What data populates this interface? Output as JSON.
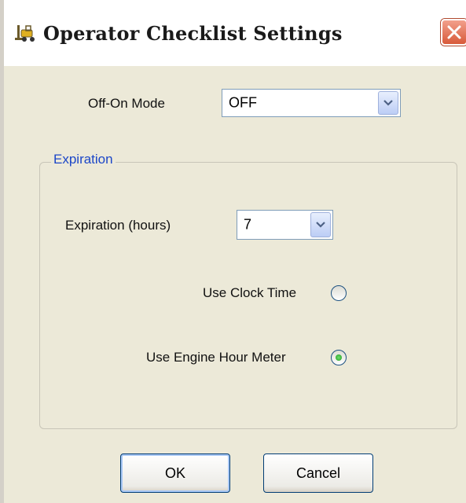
{
  "window": {
    "title": "Operator Checklist Settings",
    "icon": "forklift-icon",
    "close_icon": "close-icon"
  },
  "off_on_mode": {
    "label": "Off-On Mode",
    "selected": "OFF"
  },
  "expiration_group": {
    "legend": "Expiration",
    "hours_label": "Expiration (hours)",
    "hours_selected": "7",
    "options": [
      {
        "label": "Use Clock Time",
        "selected": false
      },
      {
        "label": "Use Engine Hour Meter",
        "selected": true
      }
    ]
  },
  "buttons": {
    "ok_label": "OK",
    "cancel_label": "Cancel"
  },
  "colors": {
    "legend_blue": "#1c47c8",
    "close_red": "#d85a3a",
    "radio_selected_green": "#1f9a1f",
    "dialog_background": "#ece9d8"
  }
}
